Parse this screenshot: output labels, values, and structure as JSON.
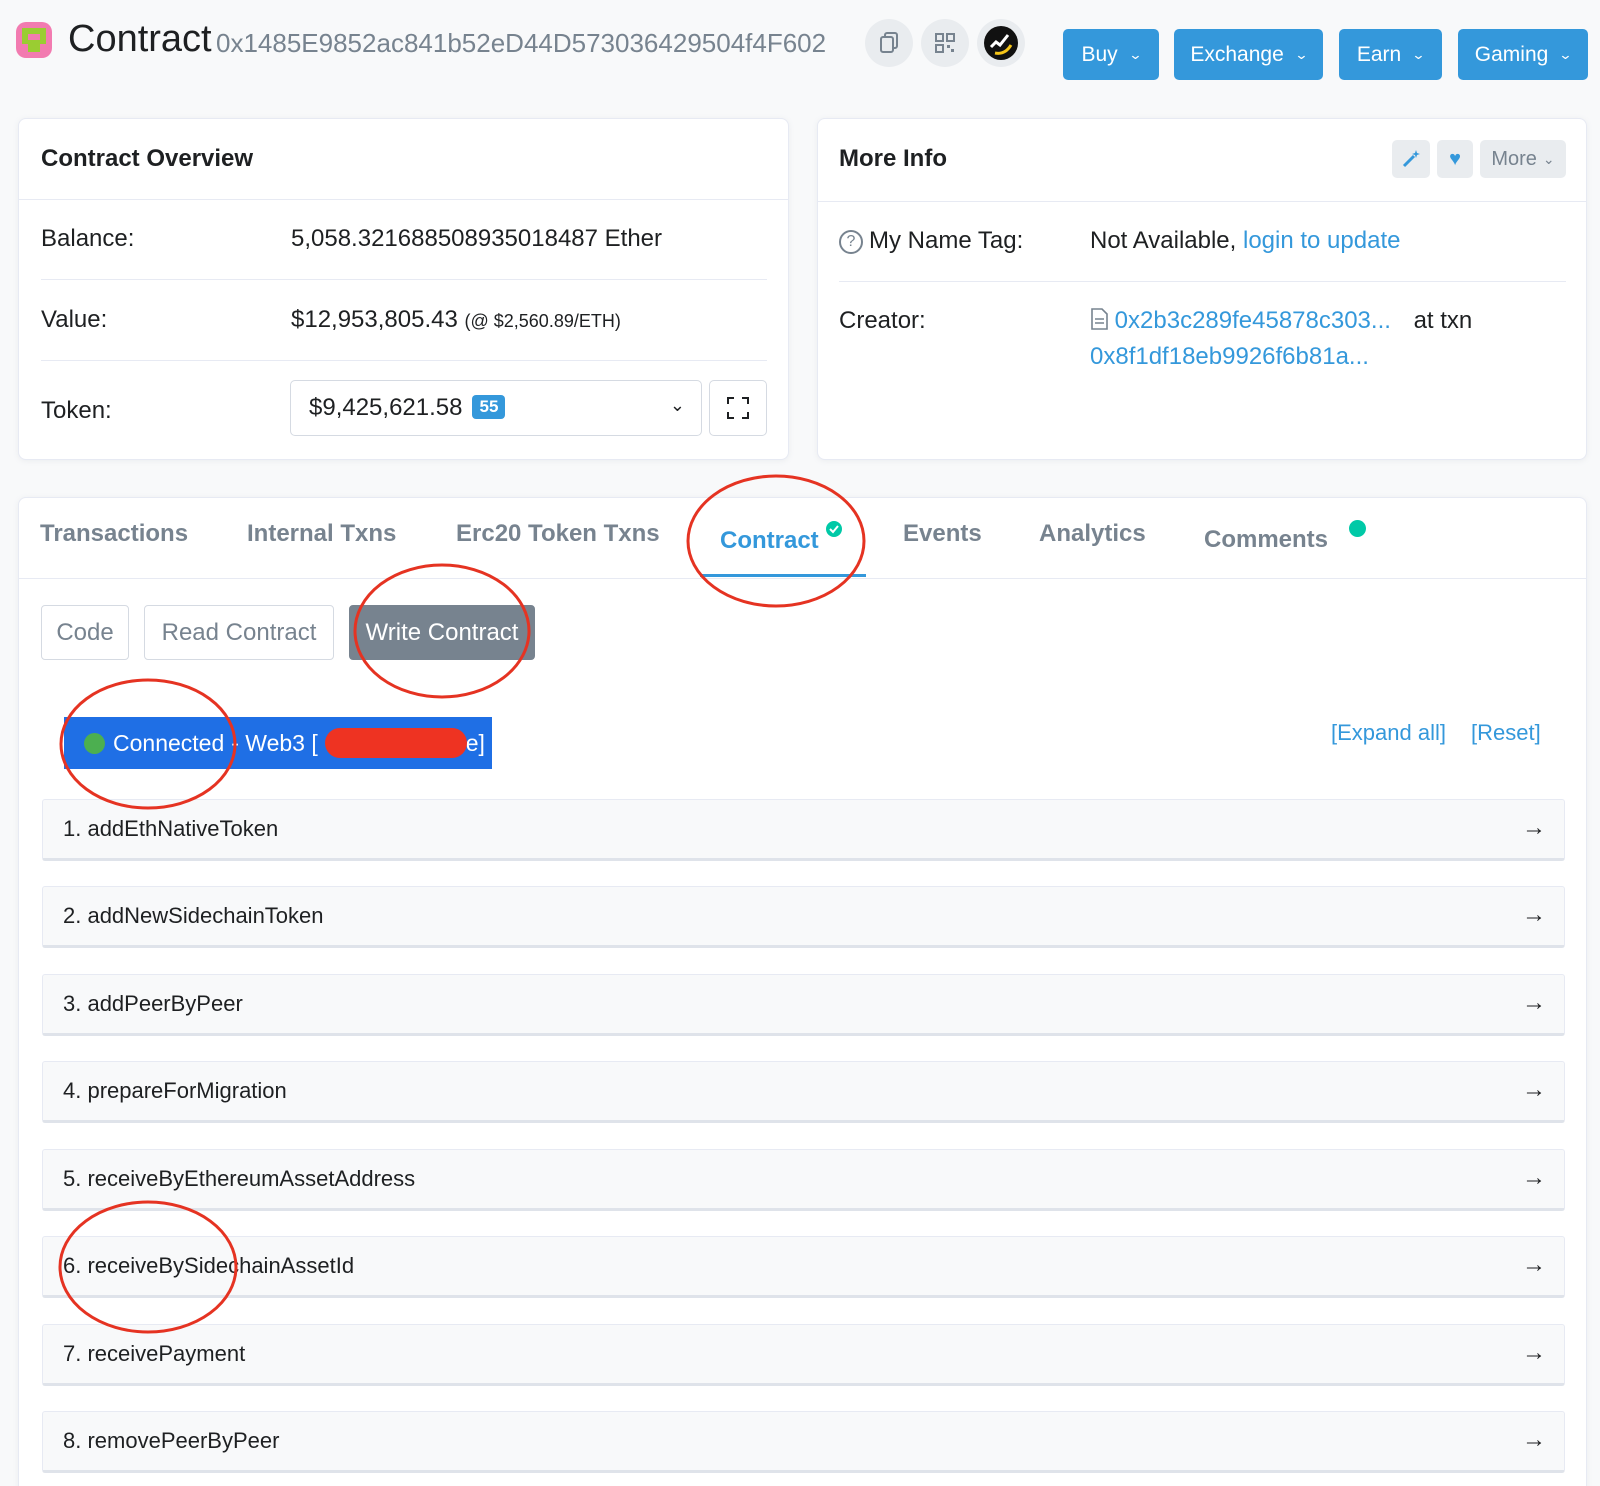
{
  "header": {
    "title": "Contract",
    "address": "0x1485E9852ac841b52eD44D573036429504f4F602",
    "nav": [
      {
        "label": "Buy"
      },
      {
        "label": "Exchange"
      },
      {
        "label": "Earn"
      },
      {
        "label": "Gaming"
      }
    ]
  },
  "overview": {
    "title": "Contract Overview",
    "balance_label": "Balance:",
    "balance_value": "5,058.321688508935018487 Ether",
    "value_label": "Value:",
    "value_amount": "$12,953,805.43",
    "value_rate": "(@ $2,560.89/ETH)",
    "token_label": "Token:",
    "token_value": "$9,425,621.58",
    "token_count": "55"
  },
  "more_info": {
    "title": "More Info",
    "more_button": "More",
    "name_tag_label": "My Name Tag:",
    "name_tag_value": "Not Available,",
    "name_tag_link": "login to update",
    "creator_label": "Creator:",
    "creator_address": "0x2b3c289fe45878c303...",
    "creator_at": "at txn",
    "creator_txn": "0x8f1df18eb9926f6b81a..."
  },
  "tabs": [
    {
      "label": "Transactions"
    },
    {
      "label": "Internal Txns"
    },
    {
      "label": "Erc20 Token Txns"
    },
    {
      "label": "Contract"
    },
    {
      "label": "Events"
    },
    {
      "label": "Analytics"
    },
    {
      "label": "Comments"
    }
  ],
  "subtabs": [
    {
      "label": "Code"
    },
    {
      "label": "Read Contract"
    },
    {
      "label": "Write Contract"
    }
  ],
  "connection": {
    "status": "Connected",
    "provider": "- Web3 [",
    "provider_end": "e]"
  },
  "controls": {
    "expand_all": "[Expand all]",
    "reset": "[Reset]"
  },
  "functions": [
    {
      "label": "1. addEthNativeToken"
    },
    {
      "label": "2. addNewSidechainToken"
    },
    {
      "label": "3. addPeerByPeer"
    },
    {
      "label": "4. prepareForMigration"
    },
    {
      "label": "5. receiveByEthereumAssetAddress"
    },
    {
      "label": "6. receiveBySidechainAssetId"
    },
    {
      "label": "7. receivePayment"
    },
    {
      "label": "8. removePeerByPeer"
    }
  ],
  "colors": {
    "accent": "#3498db",
    "annotation": "#e53322",
    "connected_bg": "#1f6fe5",
    "status_dot": "#4caf50"
  }
}
